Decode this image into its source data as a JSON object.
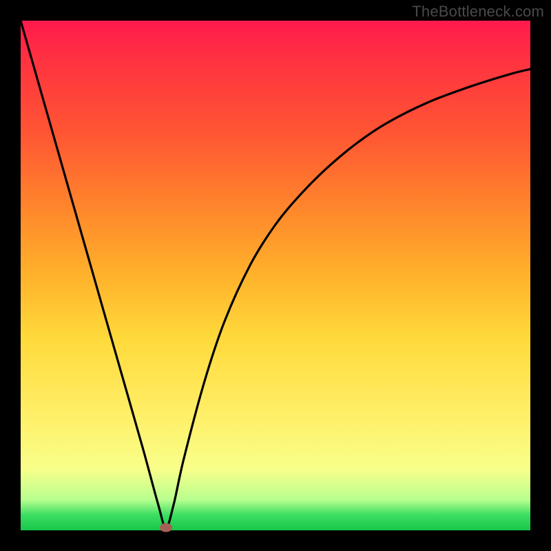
{
  "attribution": "TheBottleneck.com",
  "colors": {
    "frame": "#000000",
    "gradient_top": "#ff1a4d",
    "gradient_bottom": "#17c64a",
    "curve": "#000000",
    "marker": "#a46054"
  },
  "chart_data": {
    "type": "line",
    "title": "",
    "xlabel": "",
    "ylabel": "",
    "xlim": [
      0,
      100
    ],
    "ylim": [
      0,
      100
    ],
    "x": [
      0,
      4,
      8,
      12,
      16,
      20,
      24,
      27,
      28.5,
      30,
      32,
      36,
      40,
      45,
      50,
      55,
      60,
      66,
      72,
      80,
      88,
      96,
      100
    ],
    "values": [
      100,
      86,
      72,
      58,
      44,
      30,
      16,
      5,
      0.5,
      5,
      14,
      29,
      41,
      52,
      60,
      66,
      71,
      76,
      80,
      84,
      87,
      89.5,
      90.5
    ],
    "minimum": {
      "x": 28.5,
      "y": 0.5
    },
    "annotations": [
      "minimum-marker"
    ]
  }
}
